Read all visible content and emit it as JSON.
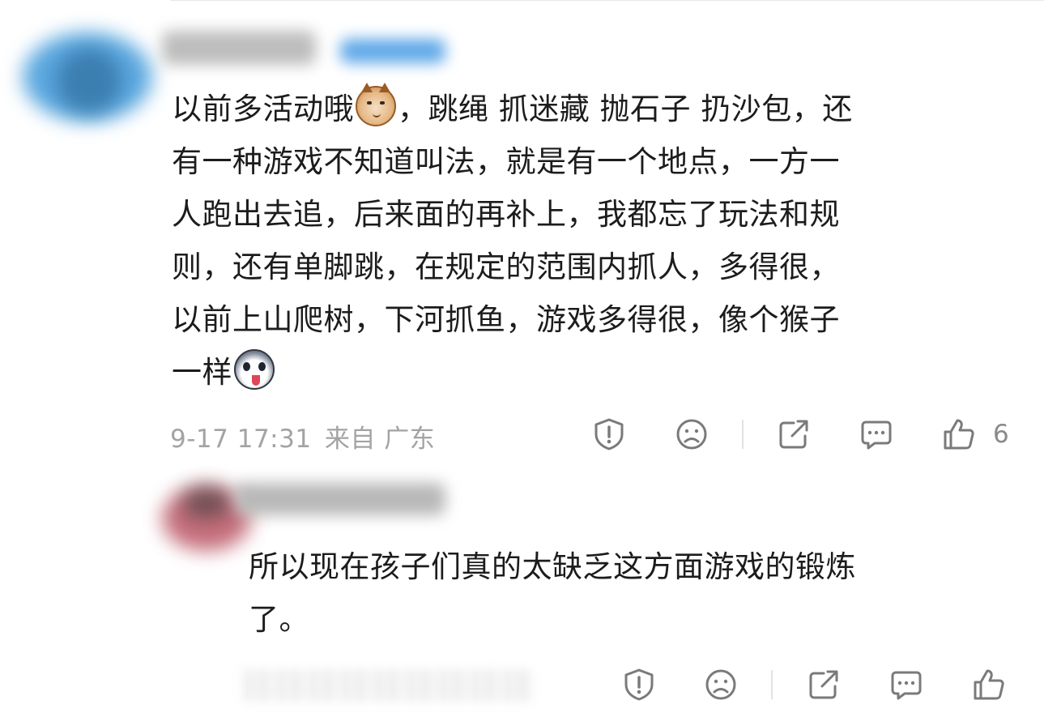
{
  "comments": [
    {
      "text_line1_a": "以前多活动哦",
      "text_line1_b": "，跳绳 抓迷藏 抛石子 扔沙包，还",
      "text_line2": "有一种游戏不知道叫法，就是有一个地点，一方一",
      "text_line3": "人跑出去追，后来面的再补上，我都忘了玩法和规",
      "text_line4": "则，还有单脚跳，在规定的范围内抓人，多得很，",
      "text_line5": "以前上山爬树，下河抓鱼，游戏多得很，像个猴子",
      "text_line6": "一样",
      "emojis": [
        "cat-emoji",
        "husky-emoji"
      ],
      "date": "9-17",
      "time": "17:31",
      "source": "来自 广东",
      "like_count": "6",
      "icons": [
        "report-icon",
        "dislike-icon",
        "share-icon",
        "comment-icon",
        "like-icon"
      ]
    },
    {
      "text_line1": "所以现在孩子们真的太缺乏这方面游戏的锻炼",
      "text_line2": "了。",
      "icons": [
        "report-icon",
        "dislike-icon",
        "share-icon",
        "comment-icon",
        "like-icon"
      ]
    }
  ],
  "colors": {
    "text": "#1c1c1c",
    "meta": "#a3a3a3",
    "icon": "#7a7a7a",
    "divider": "#e2e2e2"
  }
}
